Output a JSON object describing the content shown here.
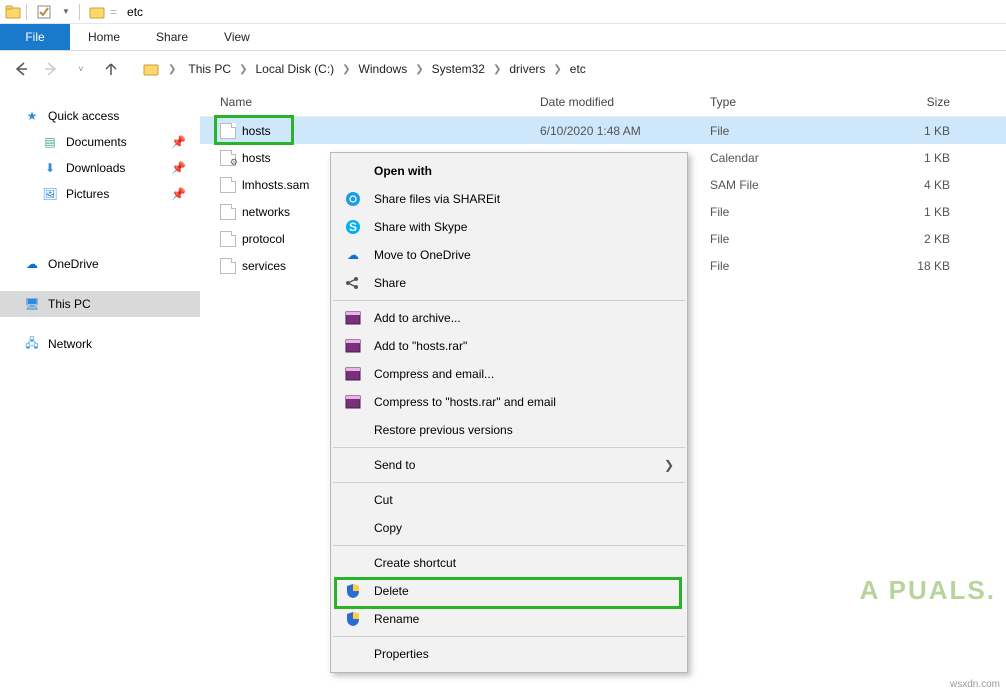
{
  "titlebar": {
    "title": "etc"
  },
  "ribbon": {
    "file": "File",
    "tabs": [
      "Home",
      "Share",
      "View"
    ]
  },
  "breadcrumbs": [
    "This PC",
    "Local Disk (C:)",
    "Windows",
    "System32",
    "drivers",
    "etc"
  ],
  "sidebar": {
    "quick_access": {
      "label": "Quick access",
      "items": [
        {
          "label": "Documents",
          "icon": "document-icon"
        },
        {
          "label": "Downloads",
          "icon": "download-icon"
        },
        {
          "label": "Pictures",
          "icon": "picture-icon"
        }
      ]
    },
    "onedrive": {
      "label": "OneDrive"
    },
    "this_pc": {
      "label": "This PC"
    },
    "network": {
      "label": "Network"
    }
  },
  "columns": {
    "name": "Name",
    "date": "Date modified",
    "type": "Type",
    "size": "Size"
  },
  "files": [
    {
      "name": "hosts",
      "date": "6/10/2020 1:48 AM",
      "type": "File",
      "size": "1 KB",
      "selected": true,
      "highlight": true
    },
    {
      "name": "hosts",
      "date": "",
      "type": "Calendar",
      "size": "1 KB",
      "selected": false,
      "cfg": true
    },
    {
      "name": "lmhosts.sam",
      "date": "",
      "type": "SAM File",
      "size": "4 KB",
      "selected": false
    },
    {
      "name": "networks",
      "date": "",
      "type": "File",
      "size": "1 KB",
      "selected": false
    },
    {
      "name": "protocol",
      "date": "",
      "type": "File",
      "size": "2 KB",
      "selected": false
    },
    {
      "name": "services",
      "date": "",
      "type": "File",
      "size": "18 KB",
      "selected": false
    }
  ],
  "context_menu": {
    "open_with": "Open with",
    "shareit": "Share files via SHAREit",
    "skype": "Share with Skype",
    "onedrive": "Move to OneDrive",
    "share": "Share",
    "add_archive": "Add to archive...",
    "add_hosts": "Add to \"hosts.rar\"",
    "compress_email": "Compress and email...",
    "compress_hosts_email": "Compress to \"hosts.rar\" and email",
    "restore": "Restore previous versions",
    "send_to": "Send to",
    "cut": "Cut",
    "copy": "Copy",
    "create_shortcut": "Create shortcut",
    "delete": "Delete",
    "rename": "Rename",
    "properties": "Properties"
  },
  "watermark": {
    "brand": "A   PUALS.",
    "site": "wsxdn.com"
  }
}
